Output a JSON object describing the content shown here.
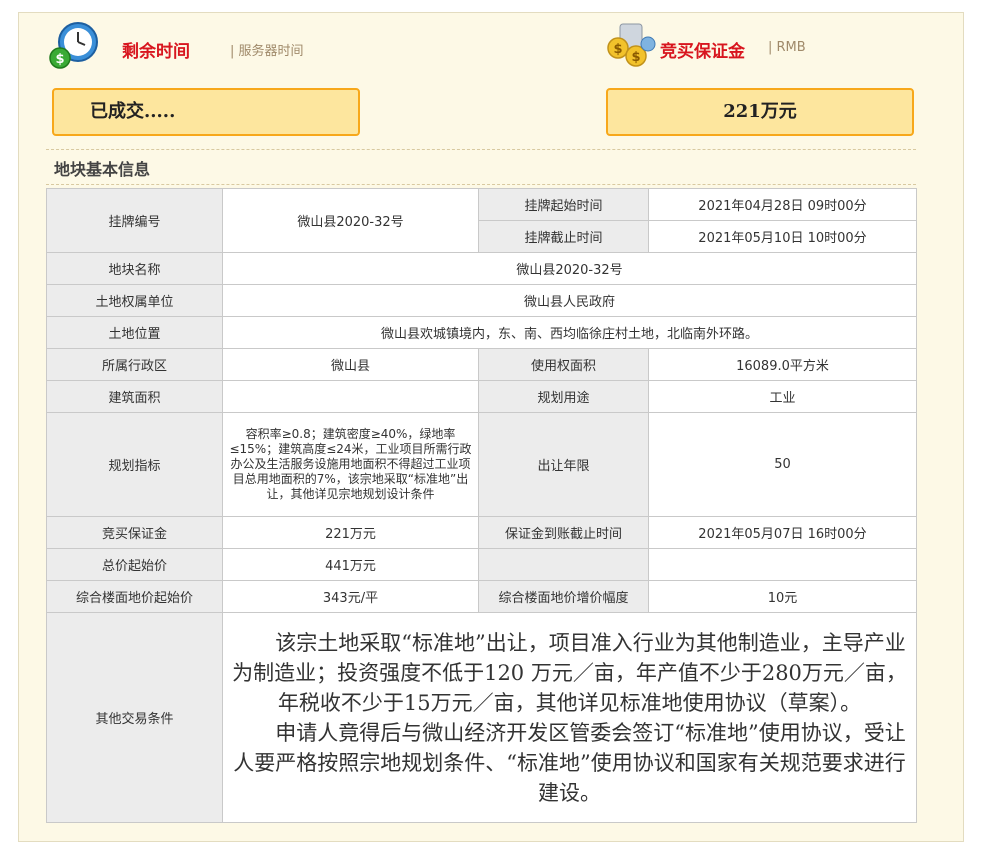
{
  "header": {
    "time_title": "剩余时间",
    "time_sub": "| 服务器时间",
    "deposit_title": "竞买保证金",
    "deposit_sub": "| RMB",
    "status_value": "已成交.....",
    "deposit_value": "221万元"
  },
  "section_title": "地块基本信息",
  "fields": {
    "listing_no_label": "挂牌编号",
    "listing_no_value": "微山县2020-32号",
    "start_time_label": "挂牌起始时间",
    "start_time_value": "2021年04月28日 09时00分",
    "end_time_label": "挂牌截止时间",
    "end_time_value": "2021年05月10日 10时00分",
    "parcel_name_label": "地块名称",
    "parcel_name_value": "微山县2020-32号",
    "owner_label": "土地权属单位",
    "owner_value": "微山县人民政府",
    "location_label": "土地位置",
    "location_value": "微山县欢城镇境内，东、南、西均临徐庄村土地，北临南外环路。",
    "district_label": "所属行政区",
    "district_value": "微山县",
    "area_label": "使用权面积",
    "area_value": "16089.0平方米",
    "build_area_label": "建筑面积",
    "build_area_value": "",
    "usage_label": "规划用途",
    "usage_value": "工业",
    "planning_label": "规划指标",
    "planning_value": "容积率≥0.8；建筑密度≥40%，绿地率≤15%；建筑高度≤24米，工业项目所需行政办公及生活服务设施用地面积不得超过工业项目总用地面积的7%，该宗地采取“标准地”出让，其他详见宗地规划设计条件",
    "term_label": "出让年限",
    "term_value": "50",
    "deposit_label": "竞买保证金",
    "deposit_value": "221万元",
    "deposit_deadline_label": "保证金到账截止时间",
    "deposit_deadline_value": "2021年05月07日 16时00分",
    "start_price_label": "总价起始价",
    "start_price_value": "441万元",
    "floor_price_label": "综合楼面地价起始价",
    "floor_price_value": "343元/平",
    "increment_label": "综合楼面地价增价幅度",
    "increment_value": "10元",
    "other_label": "其他交易条件",
    "other_p1": "该宗土地采取“标准地”出让，项目准入行业为其他制造业，主导产业为制造业；投资强度不低于120 万元／亩，年产值不少于280万元／亩，年税收不少于15万元／亩，其他详见标准地使用协议（草案）。",
    "other_p2": "申请人竟得后与微山经济开发区管委会签订“标准地”使用协议，受让人要严格按照宗地规划条件、“标准地”使用协议和国家有关规范要求进行建设。"
  },
  "colors": {
    "title_red": "#d8161f",
    "badge_fill": "#fde69e",
    "badge_border": "#f7a81b",
    "panel_bg": "#fdf9e6"
  },
  "icons": [
    "clock-money-icon",
    "coins-money-icon"
  ]
}
